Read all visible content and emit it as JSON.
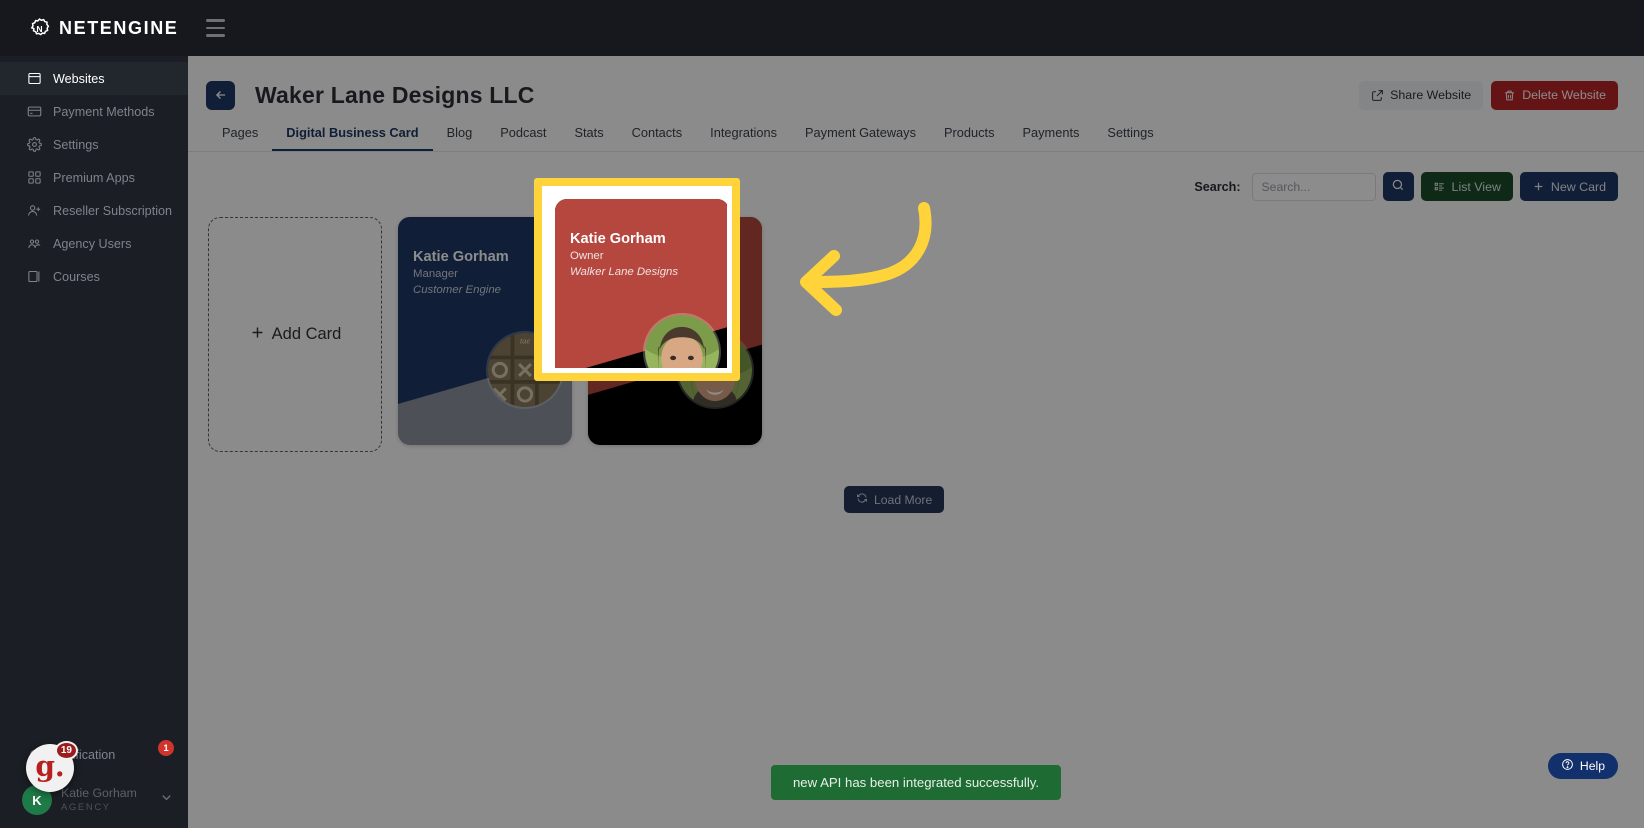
{
  "app": {
    "brand_name": "NETENGINE",
    "brand_icon": "gear-logo-icon",
    "menu_toggle_icon": "hamburger-icon"
  },
  "sidebar": {
    "items": [
      {
        "label": "Websites",
        "icon": "browser-window-icon",
        "active": true
      },
      {
        "label": "Payment Methods",
        "icon": "credit-card-icon",
        "active": false
      },
      {
        "label": "Settings",
        "icon": "gear-icon",
        "active": false
      },
      {
        "label": "Premium Apps",
        "icon": "apps-grid-icon",
        "active": false
      },
      {
        "label": "Reseller Subscription",
        "icon": "user-plus-icon",
        "active": false
      },
      {
        "label": "Agency Users",
        "icon": "users-group-icon",
        "active": false
      },
      {
        "label": "Courses",
        "icon": "book-icon",
        "active": false
      }
    ],
    "notification": {
      "label": "Notification",
      "icon": "bell-icon",
      "badge": "1"
    },
    "user": {
      "avatar_initial": "K",
      "name": "Katie Gorham",
      "role": "AGENCY",
      "caret_icon": "chevron-down-icon"
    },
    "floating_widget": {
      "glyph": "g.",
      "count": "19",
      "name": "grammarly-widget"
    }
  },
  "header": {
    "back_icon": "arrow-left-icon",
    "title": "Waker Lane Designs LLC",
    "share_label": "Share Website",
    "share_icon": "share-icon",
    "delete_label": "Delete Website",
    "delete_icon": "trash-icon"
  },
  "tabs": [
    {
      "label": "Pages",
      "active": false
    },
    {
      "label": "Digital Business Card",
      "active": true
    },
    {
      "label": "Blog",
      "active": false
    },
    {
      "label": "Podcast",
      "active": false
    },
    {
      "label": "Stats",
      "active": false
    },
    {
      "label": "Contacts",
      "active": false
    },
    {
      "label": "Integrations",
      "active": false
    },
    {
      "label": "Payment Gateways",
      "active": false
    },
    {
      "label": "Products",
      "active": false
    },
    {
      "label": "Payments",
      "active": false
    },
    {
      "label": "Settings",
      "active": false
    }
  ],
  "toolbar": {
    "search_label": "Search:",
    "search_value": "",
    "search_placeholder": "Search...",
    "search_button_icon": "search-icon",
    "list_view_label": "List View",
    "list_view_icon": "list-icon",
    "new_card_label": "New Card",
    "new_card_icon": "plus-icon"
  },
  "cards": {
    "add_card_label": "Add Card",
    "add_card_icon": "plus-icon",
    "items": [
      {
        "name": "Katie Gorham",
        "role": "Manager",
        "company": "Customer Engine",
        "theme": "navy",
        "selected": false
      },
      {
        "name": "Katie Gorham",
        "role": "Owner",
        "company": "Walker Lane Designs",
        "theme": "red",
        "selected": true
      }
    ],
    "load_more_label": "Load More",
    "load_more_icon": "refresh-icon"
  },
  "annotation": {
    "arrow_color": "#ffd43b",
    "highlight_color": "#ffd43b",
    "target": "selected business card"
  },
  "toast": {
    "message": "new API has been integrated successfully.",
    "color": "#1e6b33"
  },
  "help": {
    "label": "Help",
    "icon": "question-circle-icon"
  },
  "colors": {
    "navy": "#1e3764",
    "danger": "#b62625",
    "green": "#1b4d2b",
    "sidebar": "#1b1e24",
    "topbar": "#16181d",
    "highlight": "#ffd43b"
  }
}
